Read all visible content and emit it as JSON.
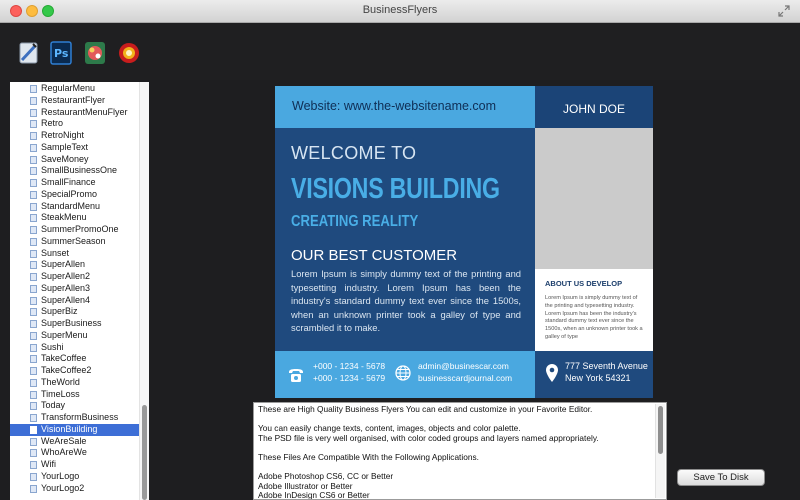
{
  "window": {
    "title": "BusinessFlyers"
  },
  "toolbar": {
    "tools": [
      {
        "icon": "notepad-icon"
      },
      {
        "icon": "photoshop-icon",
        "label": "Ps"
      },
      {
        "icon": "flyer-app-icon"
      },
      {
        "icon": "app-icon-red-circle"
      }
    ]
  },
  "templates": {
    "selected": "VisionBuilding",
    "items": [
      "RegularMenu",
      "RestaurantFlyer",
      "RestaurantMenuFlyer",
      "Retro",
      "RetroNight",
      "SampleText",
      "SaveMoney",
      "SmallBusinessOne",
      "SmallFinance",
      "SpecialPromo",
      "StandardMenu",
      "SteakMenu",
      "SummerPromoOne",
      "SummerSeason",
      "Sunset",
      "SuperAllen",
      "SuperAllen2",
      "SuperAllen3",
      "SuperAllen4",
      "SuperBiz",
      "SuperBusiness",
      "SuperMenu",
      "Sushi",
      "TakeCoffee",
      "TakeCoffee2",
      "TheWorld",
      "TimeLoss",
      "Today",
      "TransformBusiness",
      "VisionBuilding",
      "WeAreSale",
      "WhoAreWe",
      "Wifi",
      "YourLogo",
      "YourLogo2"
    ]
  },
  "flyer": {
    "website": "Website: www.the-websitename.com",
    "name": "JOHN DOE",
    "welcome": "WELCOME TO",
    "headline": "VISIONS BUILDING",
    "subheadline": "CREATING REALITY",
    "best_customer": "OUR BEST CUSTOMER",
    "body": "Lorem Ipsum is simply dummy text of the printing and typesetting industry. Lorem Ipsum has been the industry's standard dummy text ever since the 1500s, when an unknown printer took a galley of type and scrambled it to make.",
    "about_title": "ABOUT US DEVELOP",
    "about_text": "Lorem Ipsum is simply dummy text of the printing and typesetting industry. Lorem Ipsum has been the industry's standard dummy text ever since the 1500s, when an unknown printer took a galley of type",
    "phone1": "+000 - 1234 - 5678",
    "phone2": "+000 - 1234 - 5679",
    "email": "admin@businescar.com",
    "website2": "businesscardjournal.com",
    "address1": "777 Seventh Avenue",
    "address2": "New York 54321",
    "colors": {
      "dark_blue": "#1f4a7e",
      "light_blue": "#4aa8e0"
    }
  },
  "description": {
    "text": "These are High Quality Business Flyers You can edit and customize in your Favorite Editor.\n\nYou can easily change texts, content, images, objects and color palette.\nThe PSD file is very well organised, with color coded groups and layers named appropriately.\n\nThese Files Are Compatible With the Following Applications.\n\nAdobe Photoshop CS6, CC or Better\nAdobe Illustrator or Better\nAdobe InDesign CS6 or Better"
  },
  "actions": {
    "save_label": "Save To Disk"
  }
}
